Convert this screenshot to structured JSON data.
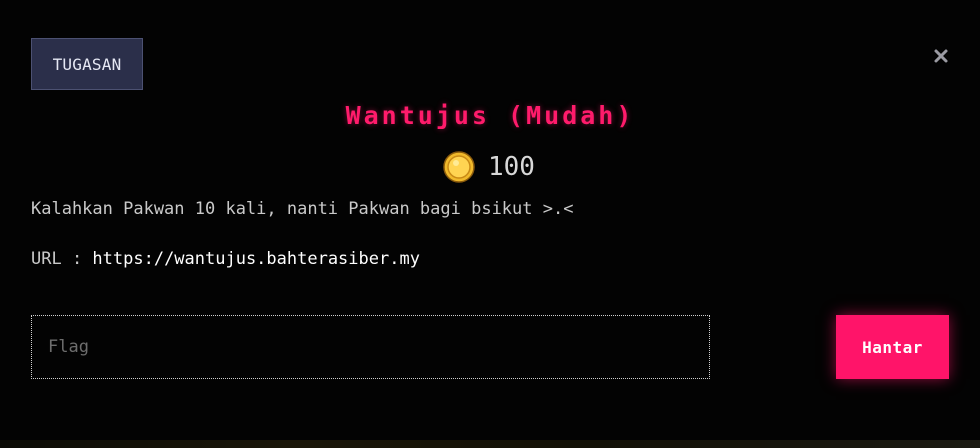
{
  "modal": {
    "tab_label": "TUGASAN",
    "title": "Wantujus (Mudah)",
    "points": "100",
    "description": "Kalahkan Pakwan 10 kali, nanti Pakwan bagi bsikut >.<",
    "url_label": "URL : ",
    "url": "https://wantujus.bahterasiber.my",
    "flag_placeholder": "Flag",
    "flag_value": "",
    "submit_label": "Hantar",
    "icons": {
      "close": "close-icon",
      "coin": "coin-icon"
    }
  },
  "colors": {
    "accent": "#ff1b6b",
    "background": "#030303",
    "tab_bg": "#2b2f4a",
    "coin": "#f2c23a"
  }
}
